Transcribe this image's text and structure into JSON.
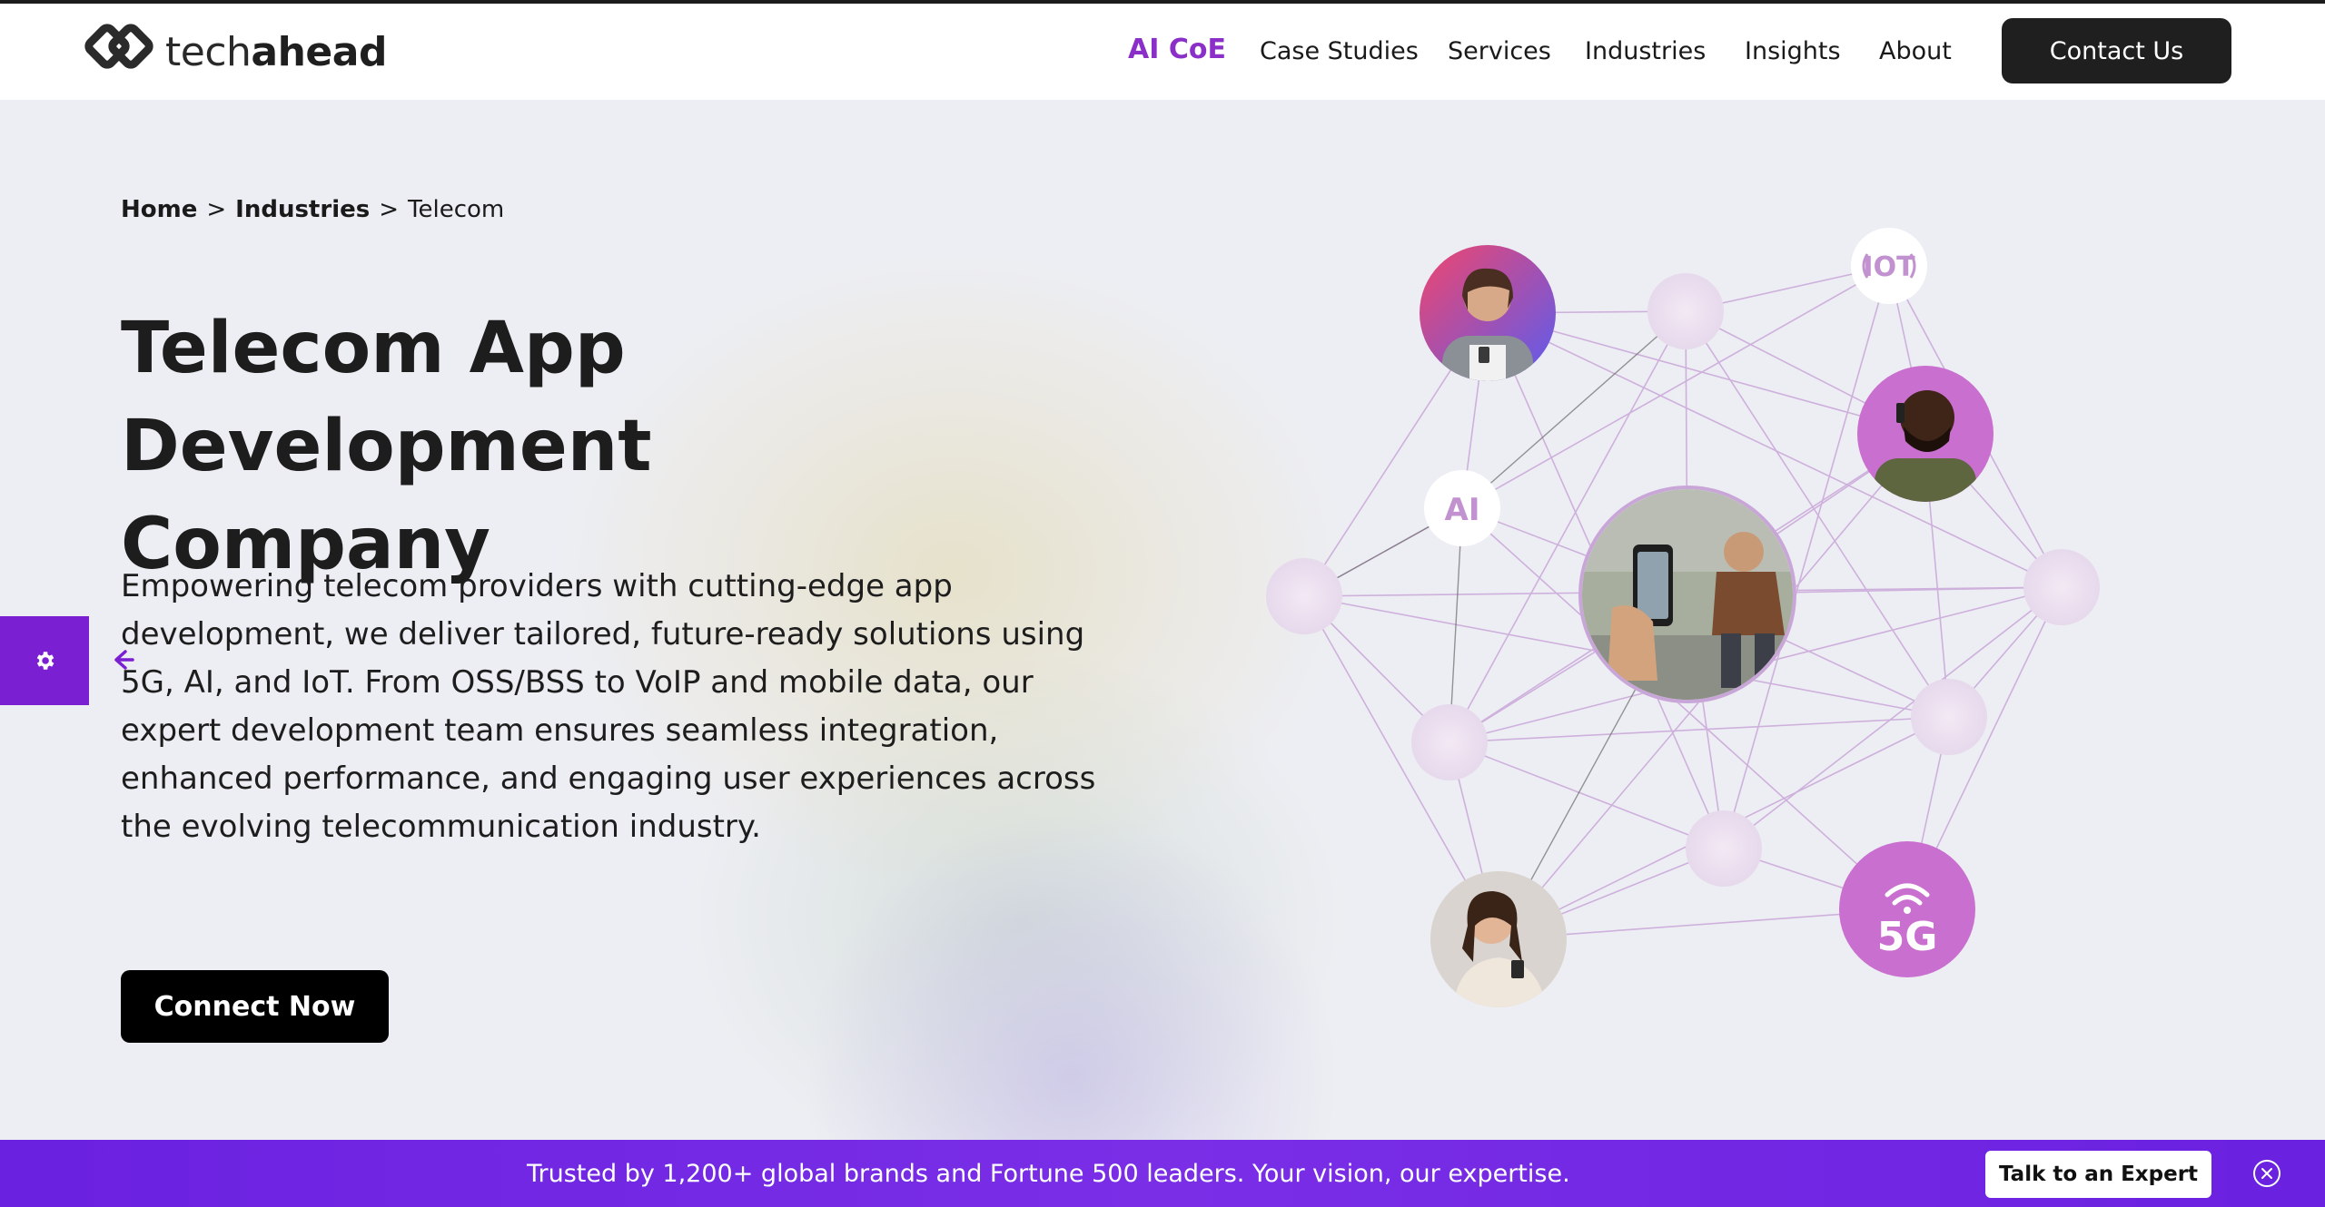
{
  "header": {
    "logo": {
      "text_light": "tech",
      "text_bold": "ahead"
    },
    "nav": [
      {
        "label": "AI CoE"
      },
      {
        "label": "Case Studies"
      },
      {
        "label": "Services"
      },
      {
        "label": "Industries"
      },
      {
        "label": "Insights"
      },
      {
        "label": "About"
      }
    ],
    "contact_label": "Contact Us"
  },
  "breadcrumb": {
    "home": "Home",
    "sep1": ">",
    "industries": "Industries",
    "sep2": ">",
    "current": "Telecom"
  },
  "hero": {
    "title_bold": "Telecom",
    "title_rest_line1": "App",
    "title_line2": "Development Company",
    "description": "Empowering telecom providers with cutting-edge app development, we deliver tailored, future-ready solutions using 5G, AI, and IoT. From OSS/BSS to VoIP and mobile data, our expert development team ensures seamless integration, enhanced performance, and engaging user experiences across the evolving telecommunication industry.",
    "cta_label": "Connect Now"
  },
  "network": {
    "badges": {
      "ai": "AI",
      "iot": "IOT",
      "fiveg": "5G"
    },
    "accent": "#c96fcf"
  },
  "banner": {
    "text": "Trusted by 1,200+ global brands and Fortune 500 leaders. Your vision, our expertise.",
    "button_label": "Talk to an Expert"
  },
  "colors": {
    "accent_purple": "#8b2fc9",
    "banner_purple": "#6a21e0",
    "dark": "#1f1f1f"
  },
  "icons": {
    "side_tab": "gear-icon",
    "side_arrow": "arrow-left-icon",
    "banner_close": "close-circle-icon"
  }
}
